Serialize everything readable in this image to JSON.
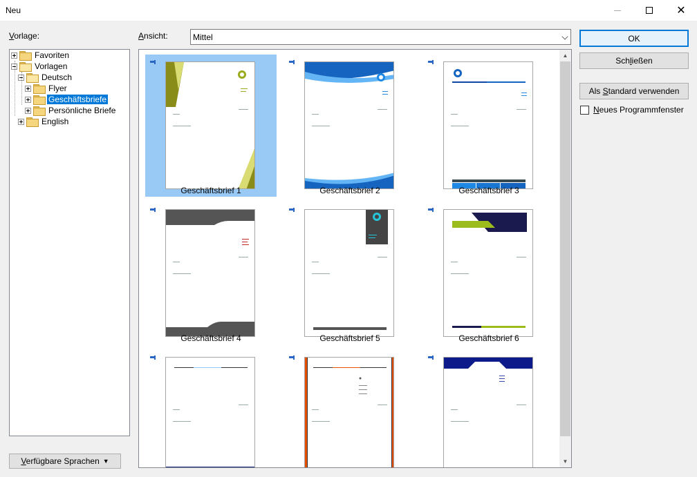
{
  "window": {
    "title": "Neu"
  },
  "labels": {
    "vorlage": "Vorlage:",
    "ansicht": "Ansicht:"
  },
  "view_select": {
    "value": "Mittel"
  },
  "tree": [
    {
      "label": "Favoriten",
      "expander": "plus",
      "level": 0
    },
    {
      "label": "Vorlagen",
      "expander": "minus",
      "level": 0
    },
    {
      "label": "Deutsch",
      "expander": "minus",
      "level": 1
    },
    {
      "label": "Flyer",
      "expander": "plus",
      "level": 2
    },
    {
      "label": "Geschäftsbriefe",
      "expander": "plus",
      "level": 2,
      "selected": true
    },
    {
      "label": "Persönliche Briefe",
      "expander": "plus",
      "level": 2
    },
    {
      "label": "English",
      "expander": "plus",
      "level": 1
    }
  ],
  "buttons": {
    "ok": "OK",
    "close": "Schließen",
    "default": "Als Standard verwenden",
    "languages": "Verfügbare Sprachen"
  },
  "checkbox": {
    "label": "Neues Programmfenster",
    "checked": false
  },
  "templates": [
    {
      "name": "Geschäftsbrief 1",
      "selected": true
    },
    {
      "name": "Geschäftsbrief 2"
    },
    {
      "name": "Geschäftsbrief 3"
    },
    {
      "name": "Geschäftsbrief 4"
    },
    {
      "name": "Geschäftsbrief 5"
    },
    {
      "name": "Geschäftsbrief 6"
    },
    {
      "name": ""
    },
    {
      "name": ""
    },
    {
      "name": ""
    }
  ],
  "colors": {
    "accent": "#0078d7",
    "selection": "#99c9f5"
  }
}
